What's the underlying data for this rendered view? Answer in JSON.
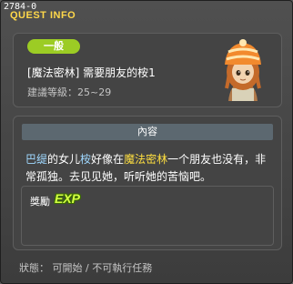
{
  "window": {
    "quest_id": "2784-0",
    "title": "QUEST INFO"
  },
  "quest": {
    "category_badge": "一般",
    "name": "[魔法密林] 需要朋友的桉1",
    "level_range": "建議等級：25~29"
  },
  "content": {
    "header": "內容",
    "desc_segments": [
      "巴缇",
      "的女儿",
      "桉",
      "好像在",
      "魔法密林",
      "一个朋友也没有，非常孤独。去见见她，听听她的苦恼吧。"
    ],
    "reward_label": "獎勵",
    "reward_icon_text": "EXP"
  },
  "footer": {
    "status": "狀態： 可開始 / 不可執行任務"
  },
  "colors": {
    "title": "#ffd84a",
    "badge": "#9ccc24",
    "npc_highlight": "#9fd8ff",
    "map_highlight": "#ffdf40"
  },
  "icons": {
    "npc_portrait": "npc-girl-portrait",
    "reward": "exp-icon"
  }
}
